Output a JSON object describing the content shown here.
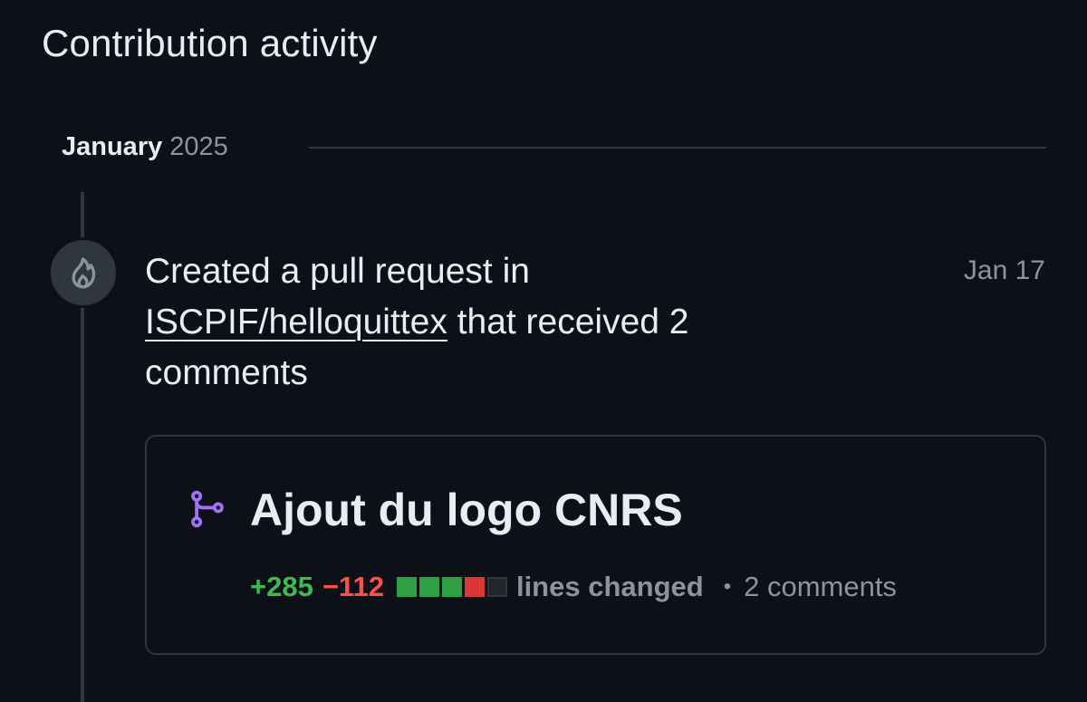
{
  "section": {
    "title": "Contribution activity"
  },
  "month": {
    "name": "January",
    "year": "2025"
  },
  "event": {
    "icon": "fire-icon",
    "text_prefix": "Created a pull request in",
    "repo": "ISCPIF/helloquittex",
    "text_suffix": "that received 2 comments",
    "date": "Jan 17"
  },
  "pull_request": {
    "icon": "git-pull-request-icon",
    "title": "Ajout du logo CNRS",
    "additions": "+285",
    "deletions": "−112",
    "diffstat": [
      "add",
      "add",
      "add",
      "del",
      "neutral"
    ],
    "lines_changed_label": "lines changed",
    "separator": "•",
    "comments": "2 comments"
  },
  "colors": {
    "background": "#0d1117",
    "additions": "#3fb950",
    "deletions": "#f85149",
    "pr_icon": "#a371f7",
    "muted": "#8b949e",
    "border": "#30363d"
  }
}
